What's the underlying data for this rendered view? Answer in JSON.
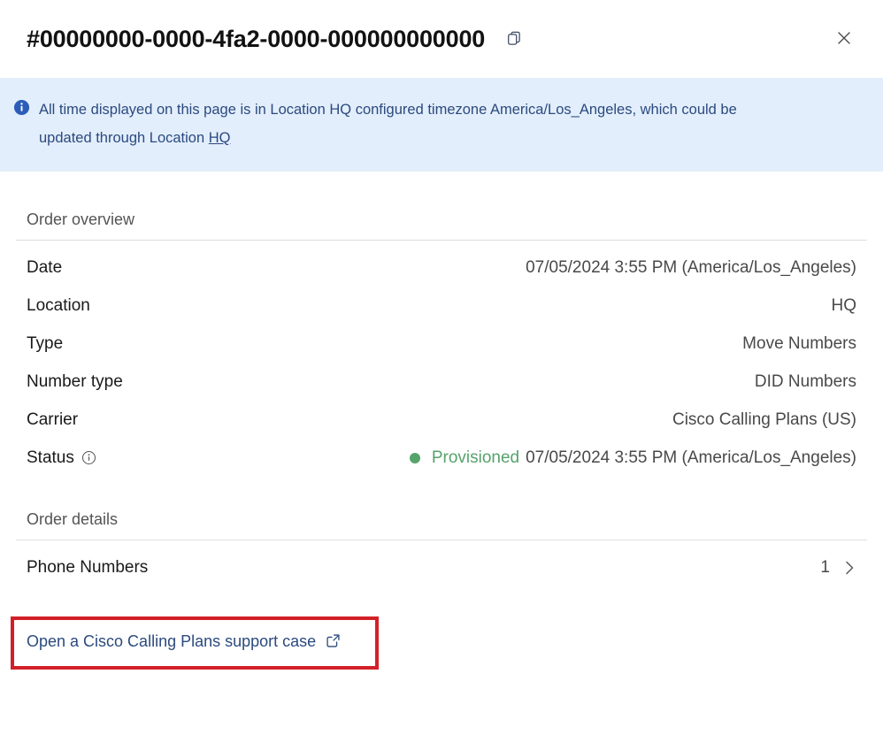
{
  "header": {
    "order_id": "#00000000-0000-4fa2-0000-000000000000",
    "copy_icon": "copy-icon",
    "close_icon": "close-icon"
  },
  "banner": {
    "icon": "info-filled-icon",
    "text_before_link": "All time displayed on this page is in Location HQ configured timezone America/Los_Angeles, which could be updated through Location ",
    "link_text": "HQ",
    "background_color": "#e3eefc",
    "text_color": "#2b4a7e"
  },
  "order_overview": {
    "title": "Order overview",
    "rows": [
      {
        "label": "Date",
        "value": "07/05/2024 3:55 PM (America/Los_Angeles)"
      },
      {
        "label": "Location",
        "value": "HQ"
      },
      {
        "label": "Type",
        "value": "Move Numbers"
      },
      {
        "label": "Number type",
        "value": "DID Numbers"
      },
      {
        "label": "Carrier",
        "value": "Cisco Calling Plans (US)"
      }
    ],
    "status_row": {
      "label": "Status",
      "info_icon": "info-outline-icon",
      "status_text": "Provisioned",
      "status_time": "07/05/2024 3:55 PM (America/Los_Angeles)",
      "status_color": "#56a36c"
    }
  },
  "order_details": {
    "title": "Order details",
    "rows": [
      {
        "label": "Phone Numbers",
        "value": "1",
        "chevron": "chevron-right-icon"
      }
    ]
  },
  "support": {
    "link_text": "Open a Cisco Calling Plans support case",
    "external_icon": "external-link-icon",
    "highlight_color": "#d32028"
  }
}
